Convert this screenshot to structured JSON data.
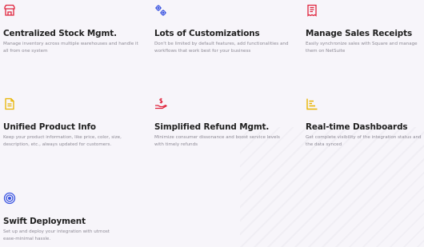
{
  "colors": {
    "red": "#e0243c",
    "blue": "#3a54e0",
    "yellow": "#e8b400",
    "title": "#1f1f1f",
    "desc": "#8c8994",
    "background": "#f7f5fa"
  },
  "features": [
    {
      "icon": "store-icon",
      "title": "Centralized Stock Mgmt.",
      "desc": "Manage inventory across multiple warehouses and handle it all from one system"
    },
    {
      "icon": "gears-icon",
      "title": "Lots of Customizations",
      "desc": "Don't be limited by default features, add functionalities and workflows that work best for your business"
    },
    {
      "icon": "receipt-icon",
      "title": "Manage Sales Receipts",
      "desc": "Easily synchronize sales with Square and manage them on NetSuite"
    },
    {
      "icon": "document-icon",
      "title": "Unified Product Info",
      "desc": "Keep your product information, like price, color, size, description, etc., always updated for customers."
    },
    {
      "icon": "refund-icon",
      "title": "Simplified Refund Mgmt.",
      "desc": "Minimize consumer dissonance and boost service levels with timely refunds"
    },
    {
      "icon": "dashboard-icon",
      "title": "Real-time Dashboards",
      "desc": "Get complete visibility of the integration status and the data synced"
    },
    {
      "icon": "target-icon",
      "title": "Swift Deployment",
      "desc": "Set up and deploy your integration with utmost ease-minimal hassle."
    }
  ]
}
